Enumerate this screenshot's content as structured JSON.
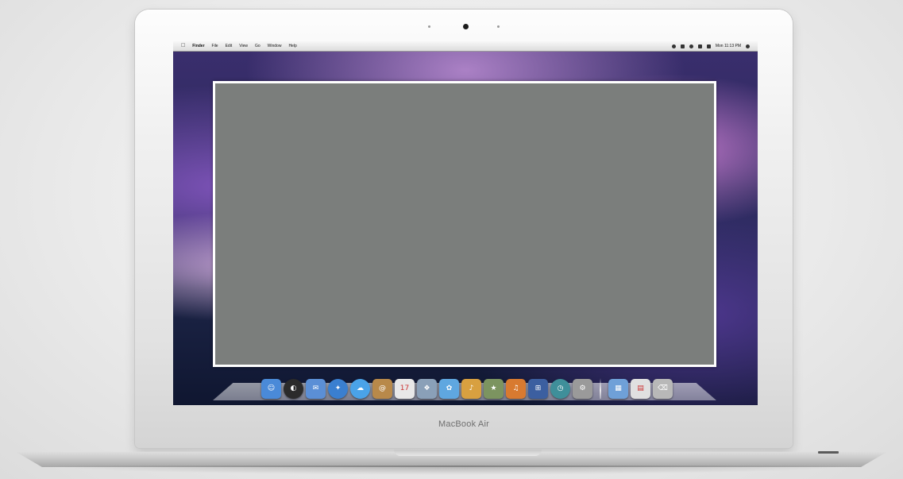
{
  "device": {
    "brand_label": "MacBook Air"
  },
  "menubar": {
    "items": [
      "Finder",
      "File",
      "Edit",
      "View",
      "Go",
      "Window",
      "Help"
    ],
    "clock": "Mon 11:13 PM"
  },
  "dock": {
    "apps": [
      {
        "icon": "finder-icon",
        "color": "#4a8ad8",
        "glyph": "☺",
        "round": false
      },
      {
        "icon": "dashboard-icon",
        "color": "#2b2b2b",
        "glyph": "◐",
        "round": true
      },
      {
        "icon": "mail-icon",
        "color": "#5b8fd6",
        "glyph": "✉",
        "round": false
      },
      {
        "icon": "safari-icon",
        "color": "#3a7fd0",
        "glyph": "✦",
        "round": true
      },
      {
        "icon": "ichat-icon",
        "color": "#4aa3e8",
        "glyph": "☁",
        "round": true
      },
      {
        "icon": "address-book-icon",
        "color": "#b8894a",
        "glyph": "@",
        "round": false
      },
      {
        "icon": "ical-icon",
        "color": "#e8e8e8",
        "glyph": "17",
        "round": false
      },
      {
        "icon": "preview-icon",
        "color": "#8aa0b8",
        "glyph": "❖",
        "round": false
      },
      {
        "icon": "iphoto-icon",
        "color": "#5fa7e0",
        "glyph": "✿",
        "round": false
      },
      {
        "icon": "itunes-icon",
        "color": "#d8a040",
        "glyph": "♪",
        "round": false
      },
      {
        "icon": "imovie-icon",
        "color": "#7c9460",
        "glyph": "★",
        "round": false
      },
      {
        "icon": "garageband-icon",
        "color": "#d87a30",
        "glyph": "♫",
        "round": false
      },
      {
        "icon": "spaces-icon",
        "color": "#3c5fa0",
        "glyph": "⊞",
        "round": false
      },
      {
        "icon": "time-machine-icon",
        "color": "#3f8f9a",
        "glyph": "◷",
        "round": true
      },
      {
        "icon": "system-preferences-icon",
        "color": "#9a9a9a",
        "glyph": "⚙",
        "round": false
      }
    ],
    "stacks": [
      {
        "icon": "applications-folder-icon",
        "color": "#6fa0d8",
        "glyph": "▦",
        "round": false
      },
      {
        "icon": "documents-stack-icon",
        "color": "#e0e0e0",
        "glyph": "▤",
        "round": false
      },
      {
        "icon": "trash-icon",
        "color": "#b8b8b8",
        "glyph": "⌫",
        "round": false
      }
    ]
  }
}
